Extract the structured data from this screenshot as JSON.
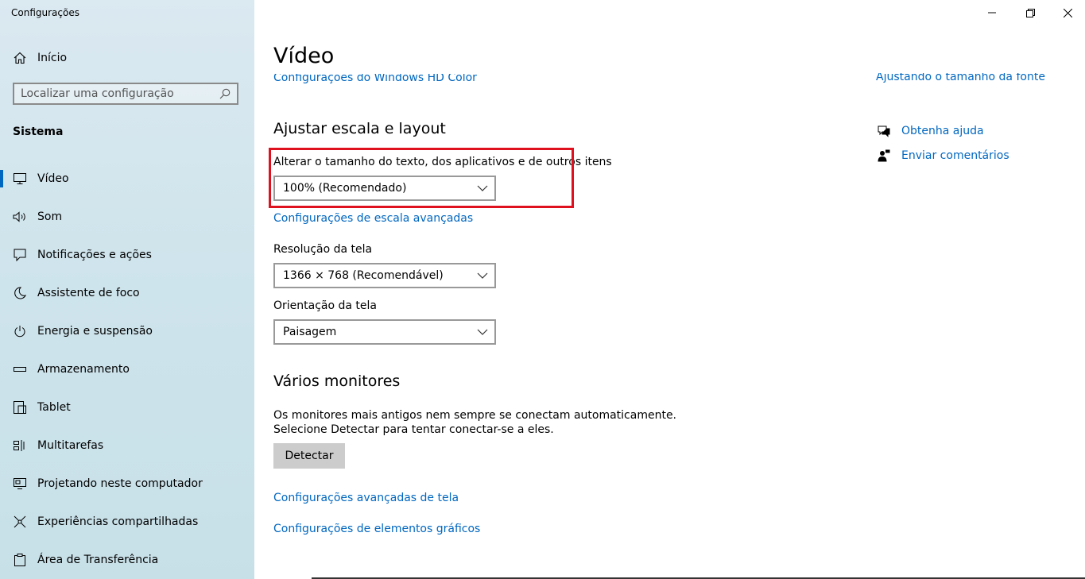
{
  "window": {
    "app_title": "Configurações",
    "minimize_label": "minimize",
    "maximize_label": "restore",
    "close_label": "close"
  },
  "sidebar": {
    "home_label": "Início",
    "search_placeholder": "Localizar uma configuração",
    "section_label": "Sistema",
    "items": [
      {
        "label": "Vídeo",
        "icon": "monitor-icon",
        "active": true
      },
      {
        "label": "Som",
        "icon": "speaker-icon"
      },
      {
        "label": "Notificações e ações",
        "icon": "notification-icon"
      },
      {
        "label": "Assistente de foco",
        "icon": "moon-icon"
      },
      {
        "label": "Energia e suspensão",
        "icon": "power-icon"
      },
      {
        "label": "Armazenamento",
        "icon": "storage-icon"
      },
      {
        "label": "Tablet",
        "icon": "tablet-icon"
      },
      {
        "label": "Multitarefas",
        "icon": "multitask-icon"
      },
      {
        "label": "Projetando neste computador",
        "icon": "project-icon"
      },
      {
        "label": "Experiências compartilhadas",
        "icon": "share-icon"
      },
      {
        "label": "Área de Transferência",
        "icon": "clipboard-icon"
      }
    ]
  },
  "main": {
    "title": "Vídeo",
    "hd_color_link": "Configurações do Windows HD Color",
    "font_size_link": "Ajustando o tamanho da fonte",
    "scale_heading": "Ajustar escala e layout",
    "scale_label": "Alterar o tamanho do texto, dos aplicativos e de outros itens",
    "scale_value": "100% (Recomendado)",
    "advanced_scale_link": "Configurações de escala avançadas",
    "resolution_label": "Resolução da tela",
    "resolution_value": "1366 × 768 (Recomendável)",
    "orientation_label": "Orientação da tela",
    "orientation_value": "Paisagem",
    "monitors_heading": "Vários monitores",
    "monitors_text_1": "Os monitores mais antigos nem sempre se conectam automaticamente.",
    "monitors_text_2": "Selecione Detectar para tentar conectar-se a eles.",
    "detect_button": "Detectar",
    "advanced_display_link": "Configurações avançadas de tela",
    "graphics_link": "Configurações de elementos gráficos",
    "help_link": "Obtenha ajuda",
    "feedback_link": "Enviar comentários"
  },
  "colors": {
    "accent": "#0067c0",
    "highlight": "#e0111f"
  }
}
